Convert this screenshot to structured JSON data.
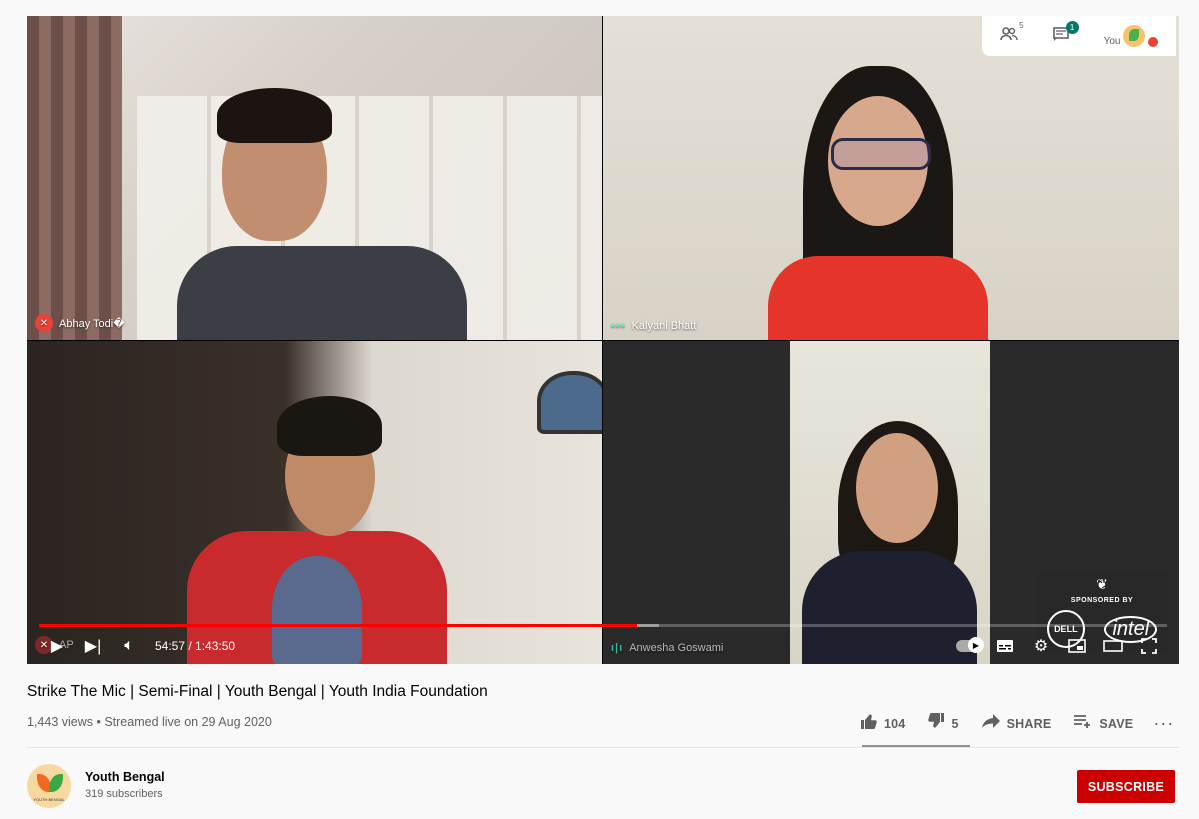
{
  "video": {
    "participants": [
      {
        "name": "Abhay Todi�",
        "status": "muted"
      },
      {
        "name": "Kalyani Bhatt",
        "status": "speaking"
      },
      {
        "name": "AP",
        "status": "muted"
      },
      {
        "name": "Anwesha Goswami",
        "status": "speaking"
      }
    ],
    "meet_bar": {
      "people_icon": "people-icon",
      "people_count": "5",
      "chat_icon": "chat-icon",
      "chat_badge": "1",
      "you_label": "You"
    },
    "sponsor": {
      "text": "SPONSORED BY",
      "brand1": "DELL",
      "brand2": "intel"
    },
    "player": {
      "progress_fraction": 0.53,
      "loaded_fraction": 0.55,
      "current_time": "54:57",
      "duration": "1:43:50",
      "time_display": "54:57 / 1:43:50",
      "icons": {
        "play": "play-icon",
        "next": "next-icon",
        "volume": "volume-icon",
        "autoplay": "autoplay-toggle",
        "captions": "captions-icon",
        "settings": "gear-icon",
        "miniplayer": "miniplayer-icon",
        "theater": "theater-icon",
        "fullscreen": "fullscreen-icon"
      },
      "colors": {
        "progress": "#ff0000",
        "muted_mic": "#ea4335"
      }
    }
  },
  "info": {
    "title": "Strike The Mic | Semi-Final | Youth Bengal | Youth India Foundation",
    "meta": "1,443 views • Streamed live on 29 Aug 2020",
    "likes": "104",
    "dislikes": "5",
    "share_label": "SHARE",
    "save_label": "SAVE",
    "more_label": "···",
    "like_ratio": 0.954
  },
  "channel": {
    "name": "Youth Bengal",
    "subscribers": "319 subscribers",
    "avatar_text": "YOUTH BENGAL",
    "subscribe_label": "SUBSCRIBE",
    "subscribe_color": "#cc0000"
  }
}
